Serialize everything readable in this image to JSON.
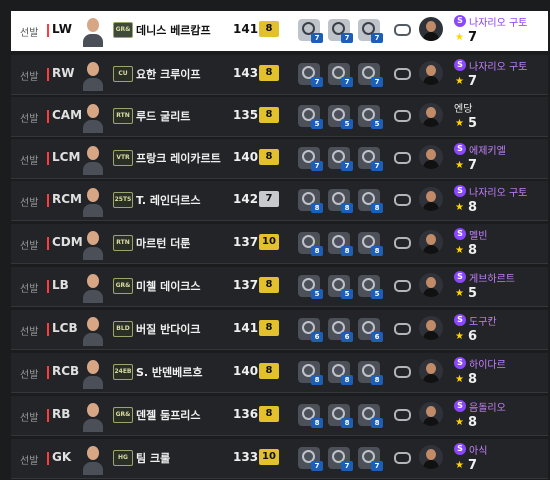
{
  "starter_label": "선발",
  "rows": [
    {
      "position": "LW",
      "season": "GR&",
      "name": "데니스 베르캄프",
      "ovr": "141",
      "level": "8",
      "level_color": "gold",
      "boosts": [
        "7",
        "7",
        "7"
      ],
      "coach": {
        "badge": "S",
        "name": "나자리오 구토",
        "level": "7"
      }
    },
    {
      "position": "RW",
      "season": "CU",
      "name": "요한 크루이프",
      "ovr": "143",
      "level": "8",
      "level_color": "gold",
      "boosts": [
        "7",
        "7",
        "7"
      ],
      "coach": {
        "badge": "S",
        "name": "나자리오 구토",
        "level": "7"
      }
    },
    {
      "position": "CAM",
      "season": "RTN",
      "name": "루드 굴리트",
      "ovr": "135",
      "level": "8",
      "level_color": "gold",
      "boosts": [
        "5",
        "5",
        "5"
      ],
      "coach": {
        "badge": "",
        "name": "엔당",
        "level": "5"
      }
    },
    {
      "position": "LCM",
      "season": "VTR",
      "name": "프랑크 레이카르트",
      "ovr": "140",
      "level": "8",
      "level_color": "gold",
      "boosts": [
        "7",
        "7",
        "7"
      ],
      "coach": {
        "badge": "S",
        "name": "에제키엘",
        "level": "7"
      }
    },
    {
      "position": "RCM",
      "season": "25TS",
      "name": "T. 레인더르스",
      "ovr": "142",
      "level": "7",
      "level_color": "silver",
      "boosts": [
        "8",
        "8",
        "8"
      ],
      "coach": {
        "badge": "S",
        "name": "나자리오 구토",
        "level": "8"
      }
    },
    {
      "position": "CDM",
      "season": "RTN",
      "name": "마르턴 더룬",
      "ovr": "137",
      "level": "10",
      "level_color": "gold",
      "boosts": [
        "8",
        "8",
        "8"
      ],
      "coach": {
        "badge": "S",
        "name": "멜빈",
        "level": "8"
      }
    },
    {
      "position": "LB",
      "season": "GR&",
      "name": "미첼 데이크스",
      "ovr": "137",
      "level": "8",
      "level_color": "gold",
      "boosts": [
        "5",
        "5",
        "5"
      ],
      "coach": {
        "badge": "S",
        "name": "게브하르트",
        "level": "5"
      }
    },
    {
      "position": "LCB",
      "season": "BLD",
      "name": "버질 반다이크",
      "ovr": "141",
      "level": "8",
      "level_color": "gold",
      "boosts": [
        "6",
        "6",
        "6"
      ],
      "coach": {
        "badge": "S",
        "name": "도구칸",
        "level": "6"
      }
    },
    {
      "position": "RCB",
      "season": "24EB",
      "name": "S. 반덴베르흐",
      "ovr": "140",
      "level": "8",
      "level_color": "gold",
      "boosts": [
        "8",
        "8",
        "8"
      ],
      "coach": {
        "badge": "S",
        "name": "하이다르",
        "level": "8"
      }
    },
    {
      "position": "RB",
      "season": "GR&",
      "name": "덴젤 둠프리스",
      "ovr": "136",
      "level": "8",
      "level_color": "gold",
      "boosts": [
        "8",
        "8",
        "8"
      ],
      "coach": {
        "badge": "S",
        "name": "음돌리오",
        "level": "8"
      }
    },
    {
      "position": "GK",
      "season": "HG",
      "name": "팀 크룰",
      "ovr": "133",
      "level": "10",
      "level_color": "gold",
      "boosts": [
        "7",
        "7",
        "7"
      ],
      "coach": {
        "badge": "S",
        "name": "아식",
        "level": "7"
      }
    }
  ]
}
